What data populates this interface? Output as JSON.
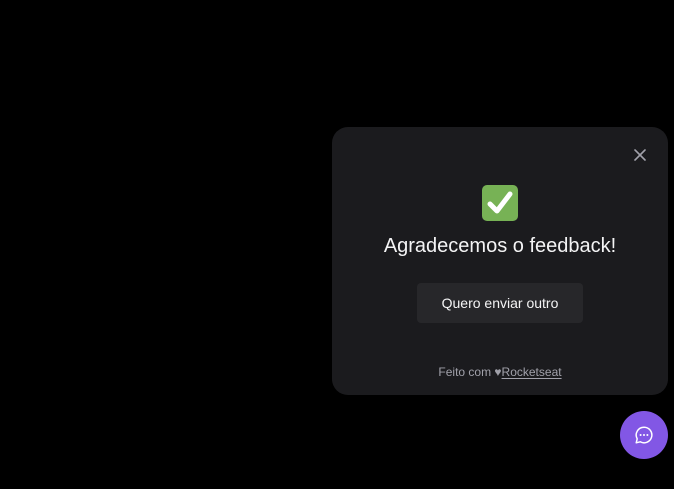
{
  "widget": {
    "title": "Agradecemos o feedback!",
    "send_again_label": "Quero enviar outro",
    "footer_prefix": "Feito com ",
    "footer_heart": "♥",
    "footer_link": "Rocketseat",
    "success_icon": "white-check-mark-icon",
    "close_icon": "close-icon"
  },
  "fab": {
    "icon": "chat-bubble-icon",
    "color": "#8257e5"
  },
  "colors": {
    "background": "#000000",
    "panel": "#1b1b1e",
    "button": "#27272a",
    "success": "#77b255"
  }
}
